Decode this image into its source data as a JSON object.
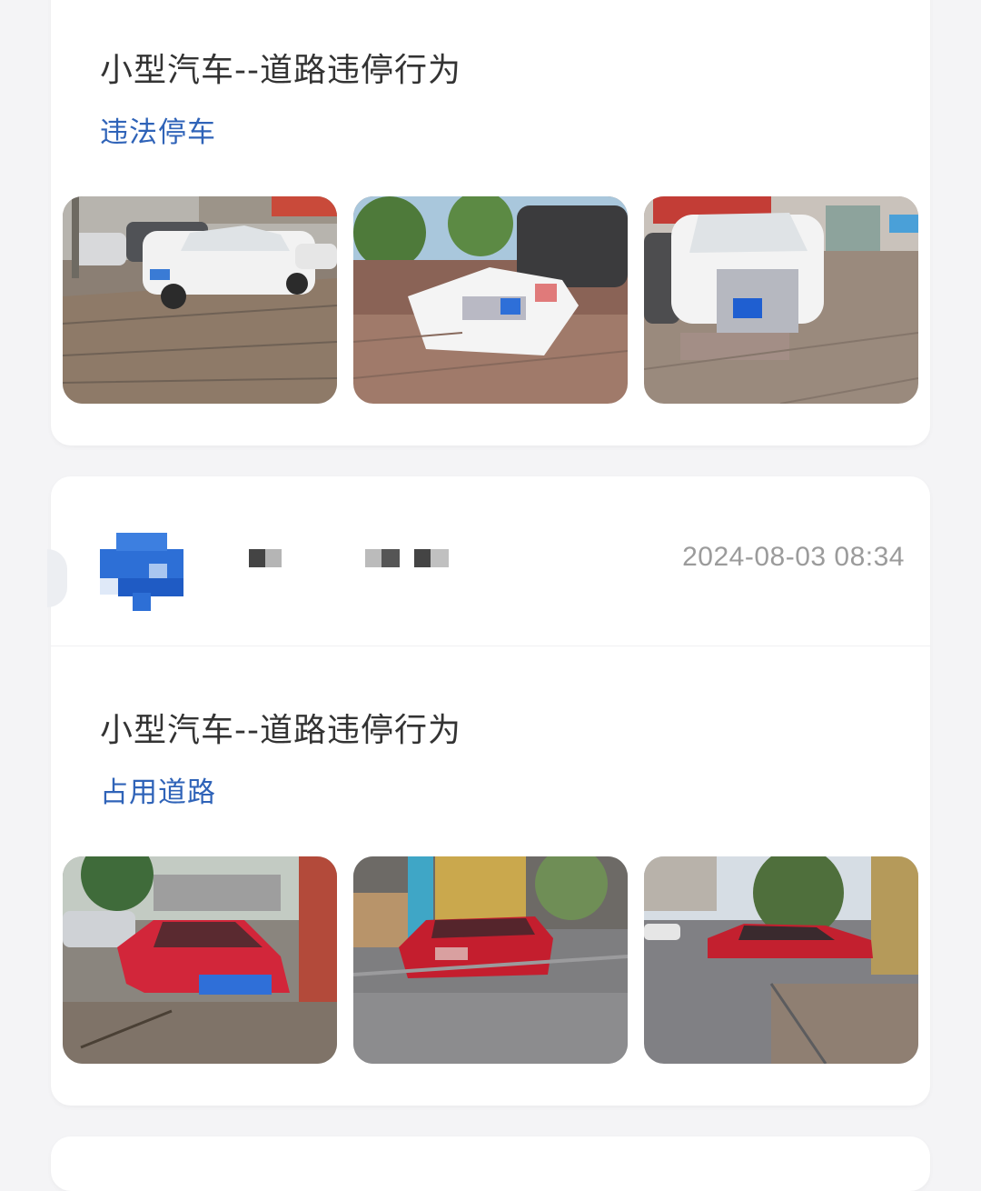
{
  "posts": [
    {
      "title": "小型汽车--道路违停行为",
      "tag": "违法停车",
      "photos": [
        "white-sedan-photo",
        "white-sedan-rear-photo",
        "white-sedan-front-photo"
      ]
    },
    {
      "timestamp": "2024-08-03 08:34",
      "title": "小型汽车--道路违停行为",
      "tag": "占用道路",
      "photos": [
        "red-sedan-front-photo",
        "red-sedan-rear-photo",
        "red-sedan-side-photo"
      ]
    }
  ],
  "colors": {
    "accent": "#2f63b8",
    "title": "#333333",
    "timestamp": "#9b9b9b",
    "background": "#f4f4f6"
  }
}
